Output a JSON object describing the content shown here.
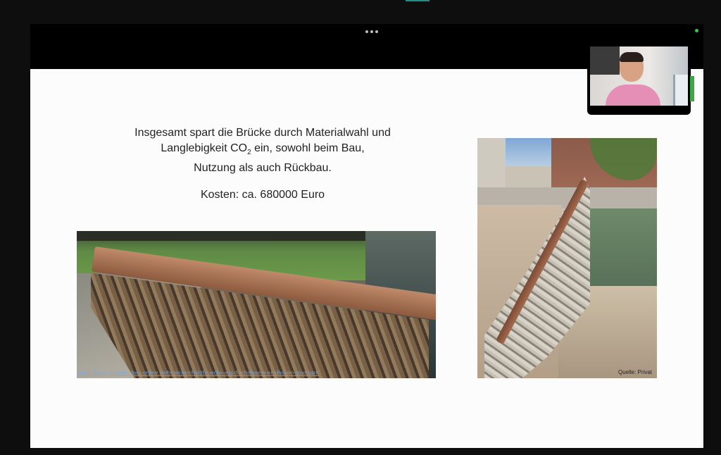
{
  "app": {
    "more_options_icon": "ellipsis-icon",
    "status_indicator_color": "#2ecc40"
  },
  "slide": {
    "line1": "Insgesamt spart die Brücke durch Materialwahl und",
    "line2_pre": "Langlebigkeit CO",
    "line2_sub": "2",
    "line2_post": " ein, sowohl beim Bau,",
    "line3": "Nutzung als auch Rückbau.",
    "cost": "Kosten: ca. 680000 Euro",
    "left_photo_link": "https://www.ingenieurbau-online.de/bruecken/holzbruecke-aus-flachsfasern-eindhoven-stadtpark",
    "right_photo_credit": "Quelle: Privat"
  }
}
